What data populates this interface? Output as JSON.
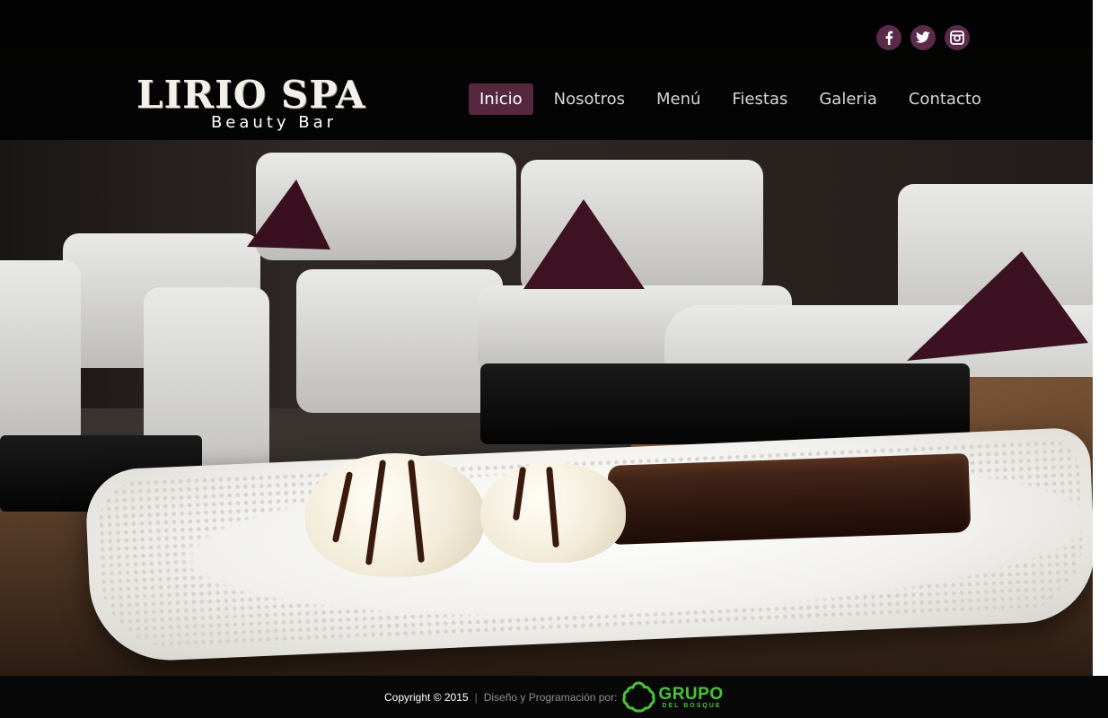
{
  "brand": {
    "title": "LIRIO SPA",
    "subtitle": "Beauty Bar"
  },
  "social": [
    {
      "name": "facebook-icon",
      "glyph": "f"
    },
    {
      "name": "twitter-icon",
      "glyph": "t"
    },
    {
      "name": "instagram-icon",
      "glyph": "i"
    }
  ],
  "nav": {
    "items": [
      {
        "label": "Inicio",
        "active": true
      },
      {
        "label": "Nosotros"
      },
      {
        "label": "Menú"
      },
      {
        "label": "Fiestas"
      },
      {
        "label": "Galeria"
      },
      {
        "label": "Contacto"
      }
    ]
  },
  "footer": {
    "copyright": "Copyright © 2015",
    "separator": "|",
    "credit": "Diseño y Programación por:",
    "company_main": "GRUPO",
    "company_sub": "DEL BOSQUE"
  },
  "colors": {
    "accent": "#55283f",
    "social_bg": "#5a2a4a",
    "company_green": "#49c33a"
  }
}
